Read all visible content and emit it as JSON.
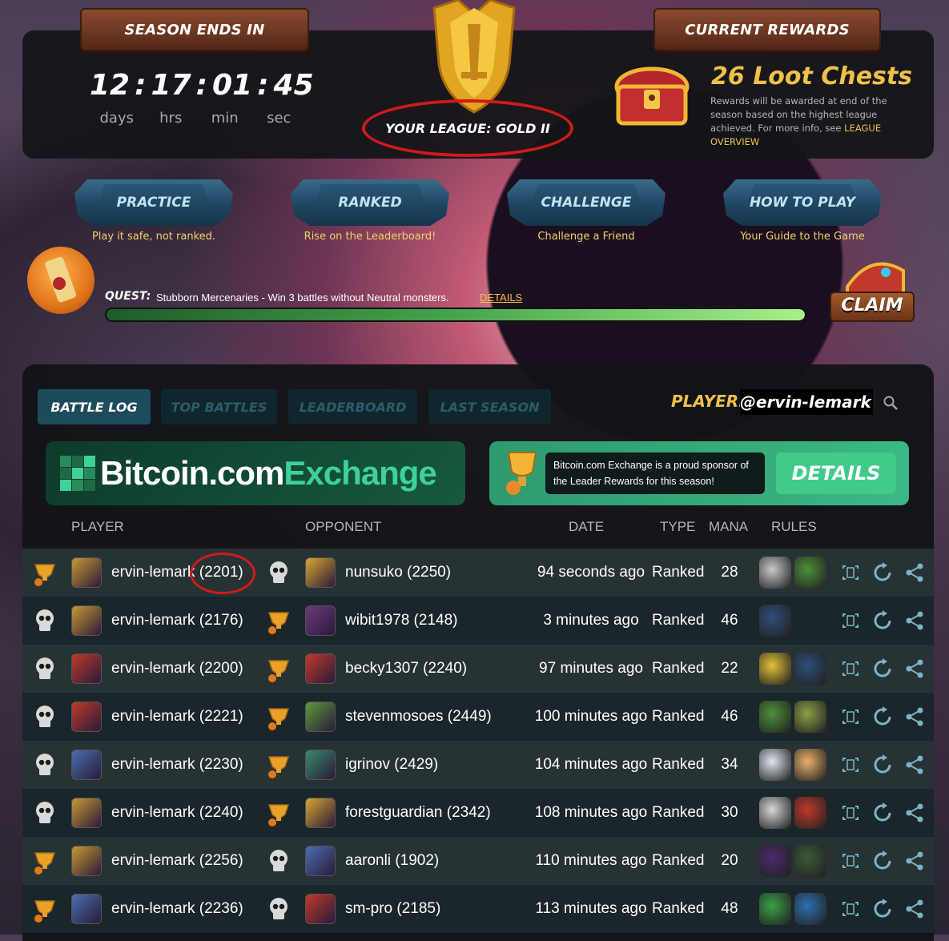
{
  "season": {
    "title": "SEASON ENDS IN",
    "timer": {
      "days": "12",
      "hrs": "17",
      "min": "01",
      "sec": "45",
      "sep": ":"
    },
    "labels": {
      "days": "days",
      "hrs": "hrs",
      "min": "min",
      "sec": "sec"
    }
  },
  "league": {
    "text": "YOUR LEAGUE: GOLD II"
  },
  "rewards": {
    "title": "CURRENT REWARDS",
    "chests": "26 Loot Chests",
    "description": "Rewards will be awarded at end of the season based on the highest league achieved. For more info, see",
    "link": "LEAGUE OVERVIEW"
  },
  "modes": [
    {
      "label": "PRACTICE",
      "sub": "Play it safe, not ranked."
    },
    {
      "label": "RANKED",
      "sub": "Rise on the Leaderboard!"
    },
    {
      "label": "CHALLENGE",
      "sub": "Challenge a Friend"
    },
    {
      "label": "HOW TO PLAY",
      "sub": "Your Guide to the Game"
    }
  ],
  "quest": {
    "label": "QUEST:",
    "text": "Stubborn Mercenaries - Win 3 battles without Neutral monsters.",
    "details": "DETAILS",
    "progress_percent": 100,
    "claim": "CLAIM"
  },
  "tabs": [
    "BATTLE LOG",
    "TOP BATTLES",
    "LEADERBOARD",
    "LAST SEASON"
  ],
  "player": {
    "label": "PLAYER:",
    "name": "@ervin-lemark"
  },
  "sponsor": {
    "brand_white": "Bitcoin.com",
    "brand_green": "Exchange",
    "text": "Bitcoin.com Exchange is a proud sponsor of the Leader Rewards for this season!",
    "button": "DETAILS"
  },
  "columns": {
    "player": "PLAYER",
    "opponent": "OPPONENT",
    "date": "DATE",
    "type": "TYPE",
    "mana": "MANA",
    "rules": "RULES"
  },
  "battles": [
    {
      "player": "ervin-lemark (2201)",
      "opponent": "nunsuko (2250)",
      "date": "94 seconds ago",
      "type": "Ranked",
      "mana": "28",
      "result": "win",
      "pcolor": "#c89a30",
      "ocolor": "#d9a633",
      "rules": [
        "#c9c9c9",
        "#4f8f3a"
      ]
    },
    {
      "player": "ervin-lemark (2176)",
      "opponent": "wibit1978 (2148)",
      "date": "3 minutes ago",
      "type": "Ranked",
      "mana": "46",
      "result": "loss",
      "pcolor": "#c89a30",
      "ocolor": "#6b3a7a",
      "rules": [
        "#2e4e7a"
      ]
    },
    {
      "player": "ervin-lemark (2200)",
      "opponent": "becky1307 (2240)",
      "date": "97 minutes ago",
      "type": "Ranked",
      "mana": "22",
      "result": "loss",
      "pcolor": "#c23a2a",
      "ocolor": "#c23a2a",
      "rules": [
        "#e0c23a",
        "#2e4e7a"
      ]
    },
    {
      "player": "ervin-lemark (2221)",
      "opponent": "stevenmosoes (2449)",
      "date": "100 minutes ago",
      "type": "Ranked",
      "mana": "46",
      "result": "loss",
      "pcolor": "#c23a2a",
      "ocolor": "#5e9a3a",
      "rules": [
        "#4f8f3a",
        "#8aa046"
      ]
    },
    {
      "player": "ervin-lemark (2230)",
      "opponent": "igrinov (2429)",
      "date": "104 minutes ago",
      "type": "Ranked",
      "mana": "34",
      "result": "loss",
      "pcolor": "#4a6fb0",
      "ocolor": "#3a8a6a",
      "rules": [
        "#dfe6ef",
        "#e8b06a"
      ]
    },
    {
      "player": "ervin-lemark (2240)",
      "opponent": "forestguardian (2342)",
      "date": "108 minutes ago",
      "type": "Ranked",
      "mana": "30",
      "result": "loss",
      "pcolor": "#c89a30",
      "ocolor": "#d9a633",
      "rules": [
        "#d7d7d7",
        "#c0392b"
      ]
    },
    {
      "player": "ervin-lemark (2256)",
      "opponent": "aaronli (1902)",
      "date": "110 minutes ago",
      "type": "Ranked",
      "mana": "20",
      "result": "win",
      "pcolor": "#c89a30",
      "ocolor": "#4a6fb0",
      "rules": [
        "#4b2a6a",
        "#3a5a3a"
      ]
    },
    {
      "player": "ervin-lemark (2236)",
      "opponent": "sm-pro (2185)",
      "date": "113 minutes ago",
      "type": "Ranked",
      "mana": "48",
      "result": "win",
      "pcolor": "#4a6fb0",
      "ocolor": "#c23a2a",
      "rules": [
        "#3aa04a",
        "#2e6fb0"
      ]
    }
  ],
  "colors": {
    "accent": "#f0c048",
    "win_icon": "#e8a12a",
    "loss_icon": "#d9d9d9",
    "highlight": "#d11a1a",
    "action_icon": "#7fb3c6"
  }
}
